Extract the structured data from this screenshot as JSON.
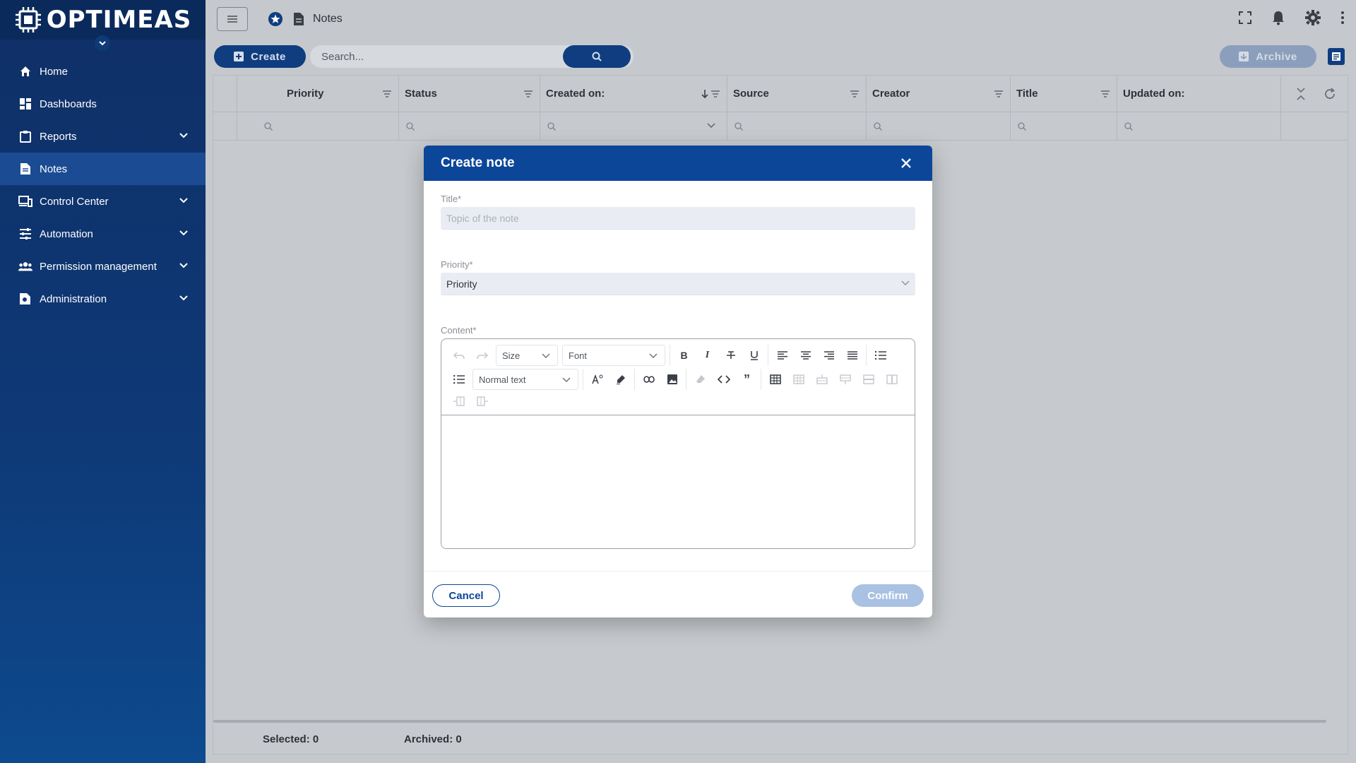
{
  "app": {
    "brand": "OPTIMEAS"
  },
  "sidebar": {
    "items": [
      {
        "label": "Home",
        "icon": "home-icon",
        "expandable": false,
        "active": false
      },
      {
        "label": "Dashboards",
        "icon": "dashboard-icon",
        "expandable": false,
        "active": false
      },
      {
        "label": "Reports",
        "icon": "clipboard-icon",
        "expandable": true,
        "active": false
      },
      {
        "label": "Notes",
        "icon": "document-icon",
        "expandable": false,
        "active": true
      },
      {
        "label": "Control Center",
        "icon": "devices-icon",
        "expandable": true,
        "active": false
      },
      {
        "label": "Automation",
        "icon": "sliders-icon",
        "expandable": true,
        "active": false
      },
      {
        "label": "Permission management",
        "icon": "people-icon",
        "expandable": true,
        "active": false
      },
      {
        "label": "Administration",
        "icon": "admin-document-icon",
        "expandable": true,
        "active": false
      }
    ]
  },
  "topbar": {
    "breadcrumb": "Notes"
  },
  "toolbar": {
    "create_label": "Create",
    "search_placeholder": "Search...",
    "archive_label": "Archive"
  },
  "grid": {
    "columns": [
      "Priority",
      "Status",
      "Created on:",
      "Source",
      "Creator",
      "Title",
      "Updated on:"
    ],
    "sorted_column": "Created on:",
    "sort_direction": "descending",
    "rows": []
  },
  "footer": {
    "selected": "Selected: 0",
    "archived": "Archived: 0"
  },
  "modal": {
    "title": "Create note",
    "title_label": "Title*",
    "title_placeholder": "Topic of the note",
    "priority_label": "Priority*",
    "priority_value": "Priority",
    "content_label": "Content*",
    "editor": {
      "size_select": "Size",
      "font_select": "Font",
      "block_select": "Normal text"
    },
    "cancel_label": "Cancel",
    "confirm_label": "Confirm"
  },
  "colors": {
    "primary": "#0b4699",
    "sidebar_bg": "#0f2f66",
    "confirm_disabled": "#a9c1e3"
  }
}
